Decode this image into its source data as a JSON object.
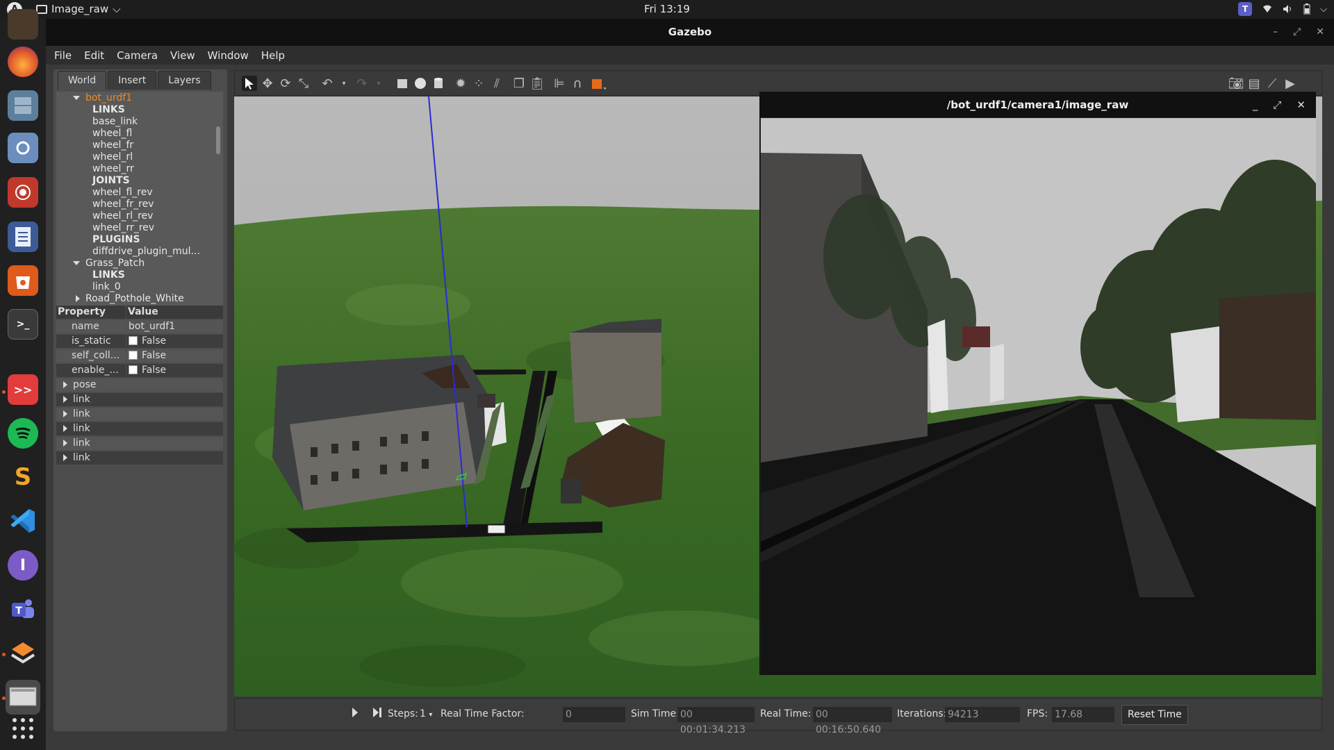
{
  "topbar": {
    "app_name": "Image_raw",
    "app_chevron": "⌵",
    "clock": "Fri 13:19",
    "activities_glyph": "A",
    "teams_glyph": "T"
  },
  "window": {
    "title": "Gazebo",
    "controls": [
      "–",
      "⤢",
      "✕"
    ]
  },
  "menu": [
    "File",
    "Edit",
    "Camera",
    "View",
    "Window",
    "Help"
  ],
  "tabs": [
    "World",
    "Insert",
    "Layers"
  ],
  "tree": {
    "model1": "bot_urdf1",
    "links_header": "LINKS",
    "links": [
      "base_link",
      "wheel_fl",
      "wheel_fr",
      "wheel_rl",
      "wheel_rr"
    ],
    "joints_header": "JOINTS",
    "joints": [
      "wheel_fl_rev",
      "wheel_fr_rev",
      "wheel_rl_rev",
      "wheel_rr_rev"
    ],
    "plugins_header": "PLUGINS",
    "plugins": [
      "diffdrive_plugin_mul..."
    ],
    "model2": "Grass_Patch",
    "model2_links_header": "LINKS",
    "model2_links": [
      "link_0"
    ],
    "model3": "Road_Pothole_White"
  },
  "properties": {
    "col_property": "Property",
    "col_value": "Value",
    "rows": [
      {
        "name": "name",
        "value": "bot_urdf1"
      },
      {
        "name": "is_static",
        "value": "False"
      },
      {
        "name": "self_coll...",
        "value": "False"
      },
      {
        "name": "enable_...",
        "value": "False"
      }
    ],
    "groups": [
      "pose",
      "link",
      "link",
      "link",
      "link",
      "link"
    ]
  },
  "camera_window": {
    "title": "/bot_urdf1/camera1/image_raw",
    "controls": [
      "_",
      "⤢",
      "✕"
    ]
  },
  "bottom": {
    "steps_label": "Steps:",
    "steps_value": "1",
    "rtf_label": "Real Time Factor:",
    "rtf_value": "0",
    "sim_label": "Sim Time:",
    "sim_value": "00 00:01:34.213",
    "real_label": "Real Time:",
    "real_value": "00 00:16:50.640",
    "iter_label": "Iterations:",
    "iter_value": "94213",
    "fps_label": "FPS:",
    "fps_value": "17.68",
    "reset_label": "Reset Time"
  },
  "colors": {
    "selected_model": "#f08a24",
    "sky": "#b3b3b3",
    "grass": "#3f6f2a",
    "road": "#141414"
  }
}
